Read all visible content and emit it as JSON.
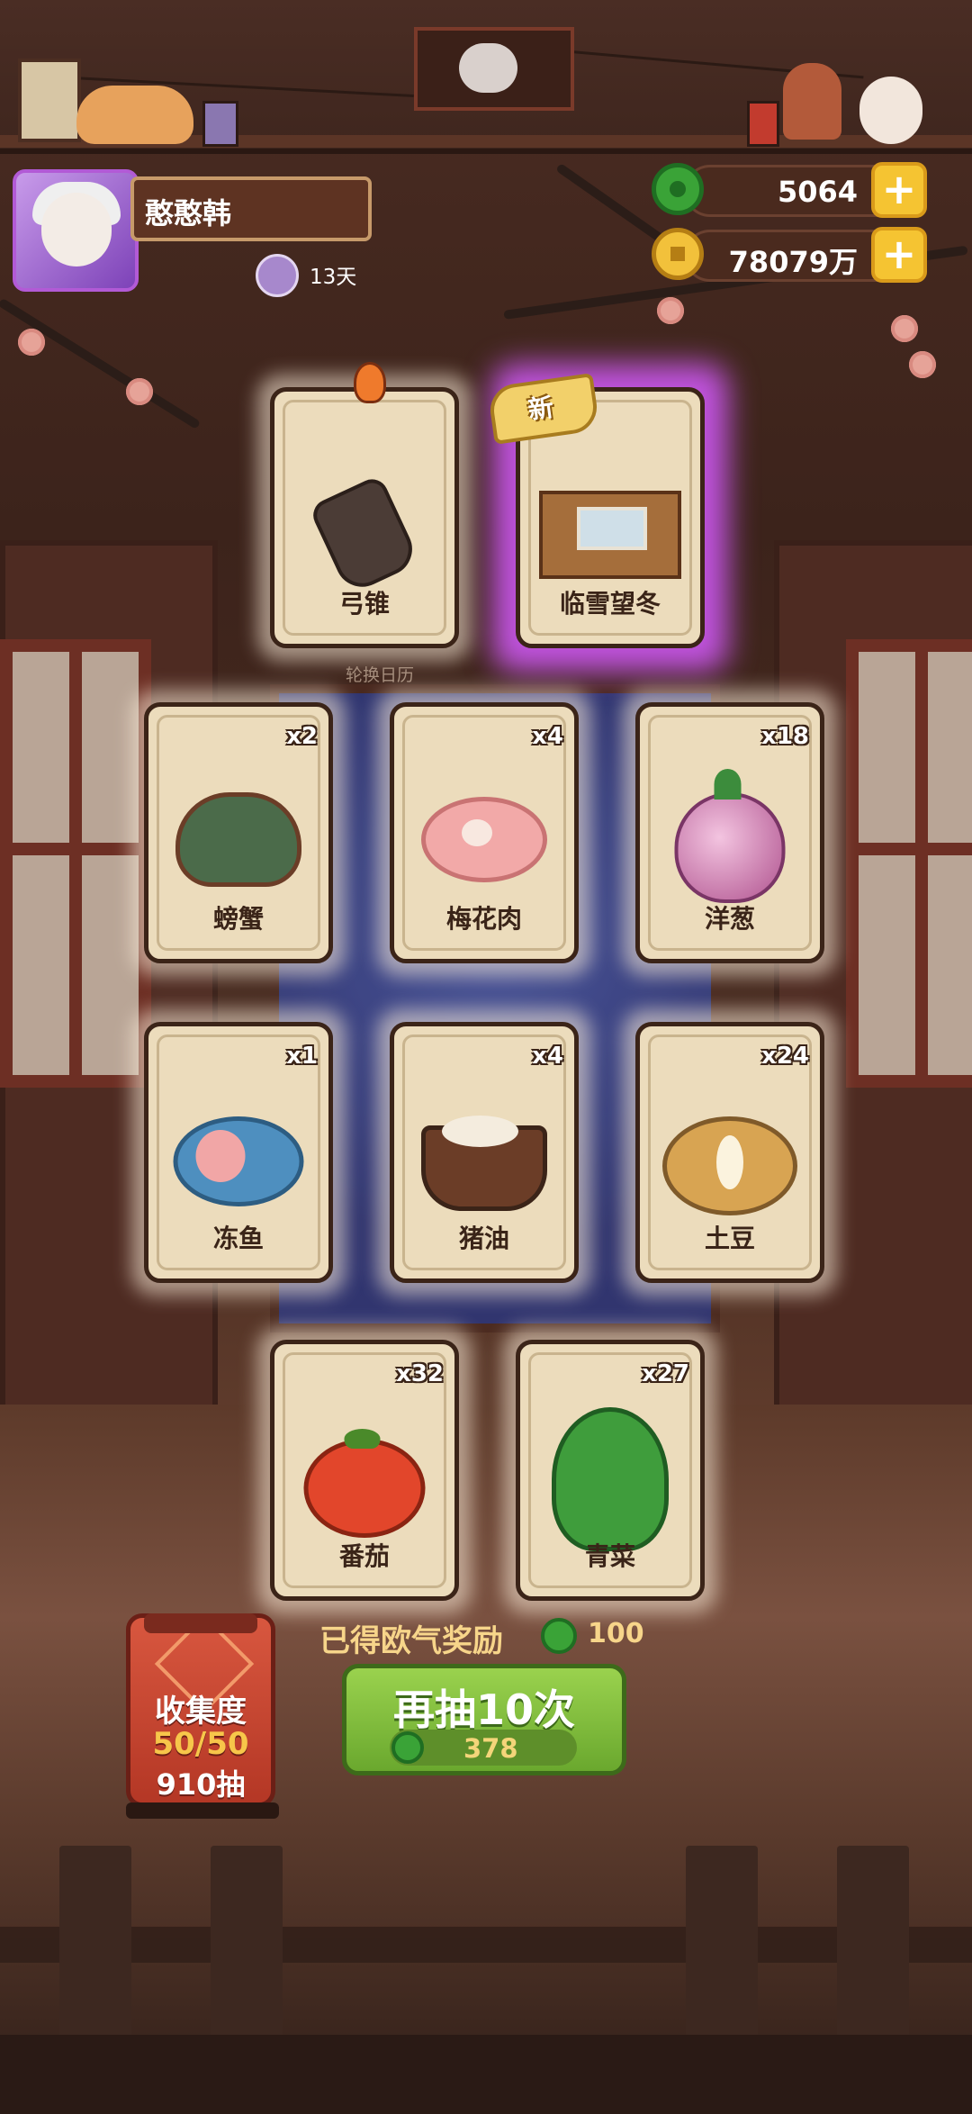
{
  "player": {
    "name": "憨憨韩",
    "days": "13天"
  },
  "currencies": {
    "jade": "5064",
    "gold": "78079万"
  },
  "featured": [
    {
      "label": "弓锥",
      "badge": ""
    },
    {
      "label": "临雪望冬",
      "badge": "新"
    }
  ],
  "rotate_label": "轮换日历",
  "cards": [
    {
      "label": "螃蟹",
      "qty": "x2",
      "icon": "crab-icon"
    },
    {
      "label": "梅花肉",
      "qty": "x4",
      "icon": "pork-icon"
    },
    {
      "label": "洋葱",
      "qty": "x18",
      "icon": "onion-icon"
    },
    {
      "label": "冻鱼",
      "qty": "x1",
      "icon": "fish-icon"
    },
    {
      "label": "猪油",
      "qty": "x4",
      "icon": "lard-icon"
    },
    {
      "label": "土豆",
      "qty": "x24",
      "icon": "potato-icon"
    },
    {
      "label": "番茄",
      "qty": "x32",
      "icon": "tomato-icon"
    },
    {
      "label": "青菜",
      "qty": "x27",
      "icon": "greens-icon"
    }
  ],
  "reward": {
    "text": "已得欧气奖励",
    "value": "100"
  },
  "draw_button": {
    "label": "再抽10次",
    "cost": "378"
  },
  "collection": {
    "title": "收集度",
    "progress": "50/50",
    "pulls": "910抽"
  },
  "colors": {
    "card_bg": "#ecdcbc",
    "draw_button": "#6aa82e",
    "lantern": "#b43725",
    "highlight_glow": "#d65aff"
  }
}
